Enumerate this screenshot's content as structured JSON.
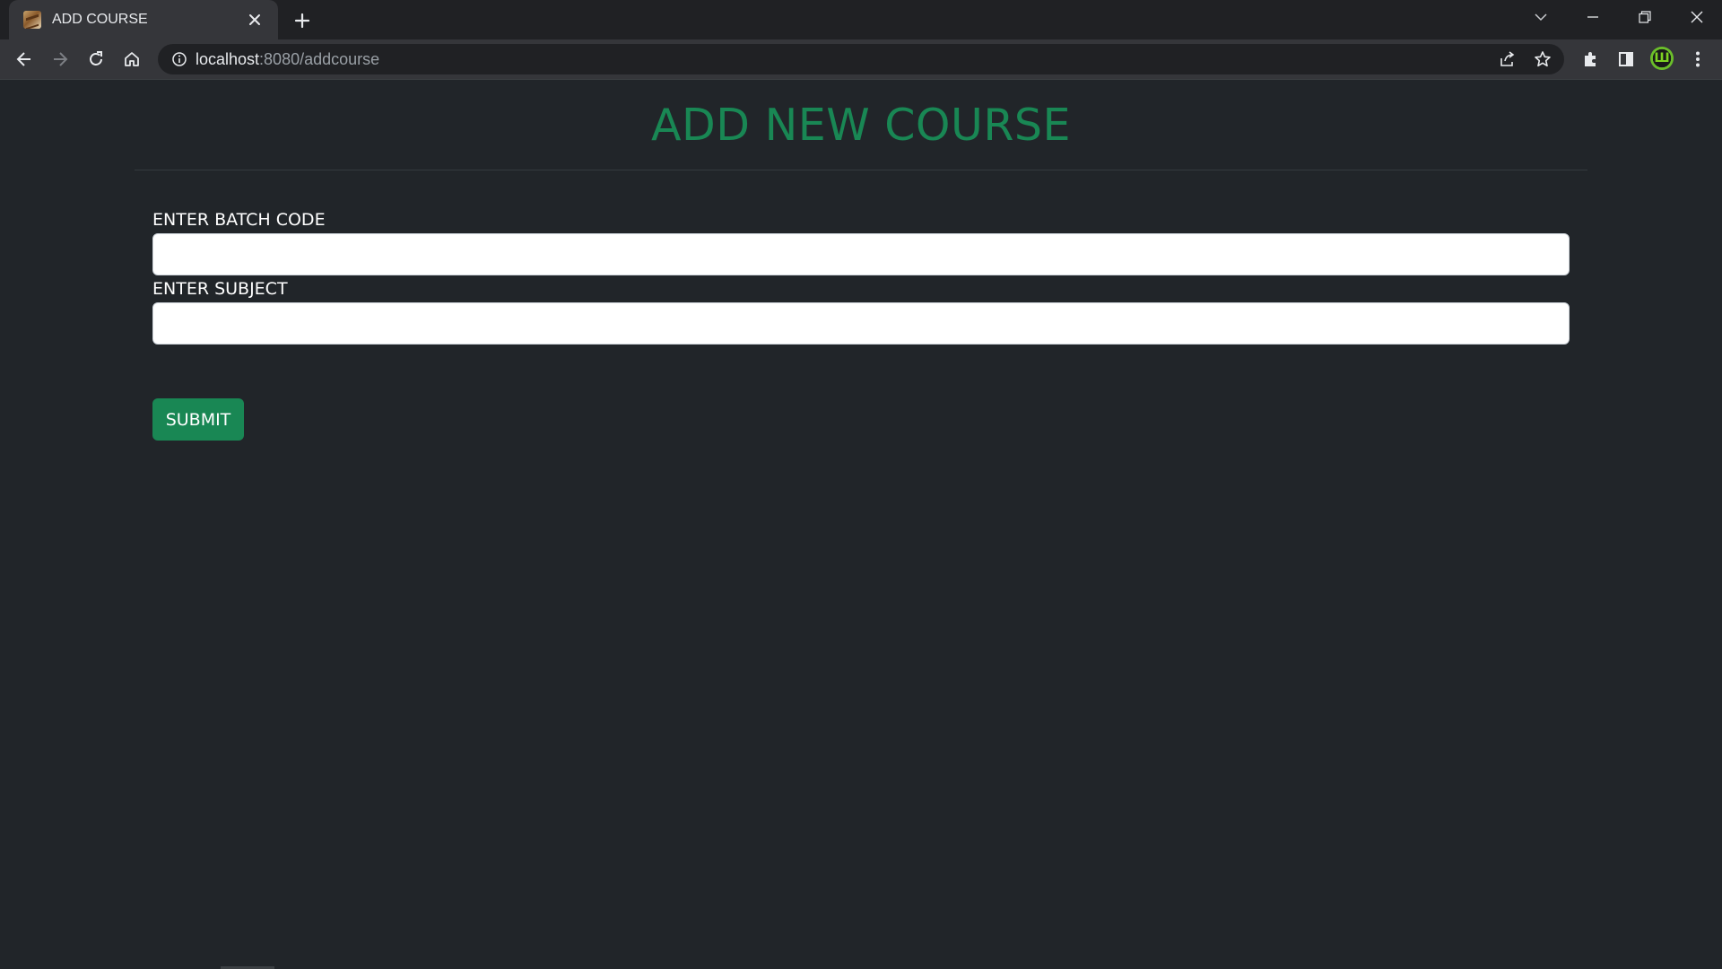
{
  "browser": {
    "tab": {
      "title": "ADD COURSE",
      "favicon": "course-favicon-icon",
      "close_icon": "close-icon"
    },
    "new_tab_icon": "plus-icon",
    "window_controls": [
      "chevron-down-icon",
      "minimize-icon",
      "restore-icon",
      "close-icon"
    ],
    "nav_icons": [
      "back-arrow-icon",
      "forward-arrow-icon",
      "reload-icon",
      "home-icon"
    ],
    "address_bar": {
      "host": "localhost",
      "rest": ":8080/addcourse",
      "info_icon": "info-icon",
      "right_icons": [
        "share-icon",
        "bookmark-star-icon"
      ]
    },
    "toolbar_icons": [
      "extensions-puzzle-icon",
      "side-panel-icon",
      "profile-avatar-icon",
      "kebab-menu-icon"
    ]
  },
  "page": {
    "heading": "ADD NEW COURSE",
    "form": {
      "batch_code": {
        "label": "ENTER BATCH CODE",
        "value": "",
        "placeholder": ""
      },
      "subject": {
        "label": "ENTER SUBJECT",
        "value": "",
        "placeholder": ""
      },
      "submit_label": "SUBMIT"
    }
  },
  "colors": {
    "background": "#212529",
    "accent": "#198754",
    "chrome_dark": "#202124",
    "chrome_toolbar": "#35363a"
  }
}
